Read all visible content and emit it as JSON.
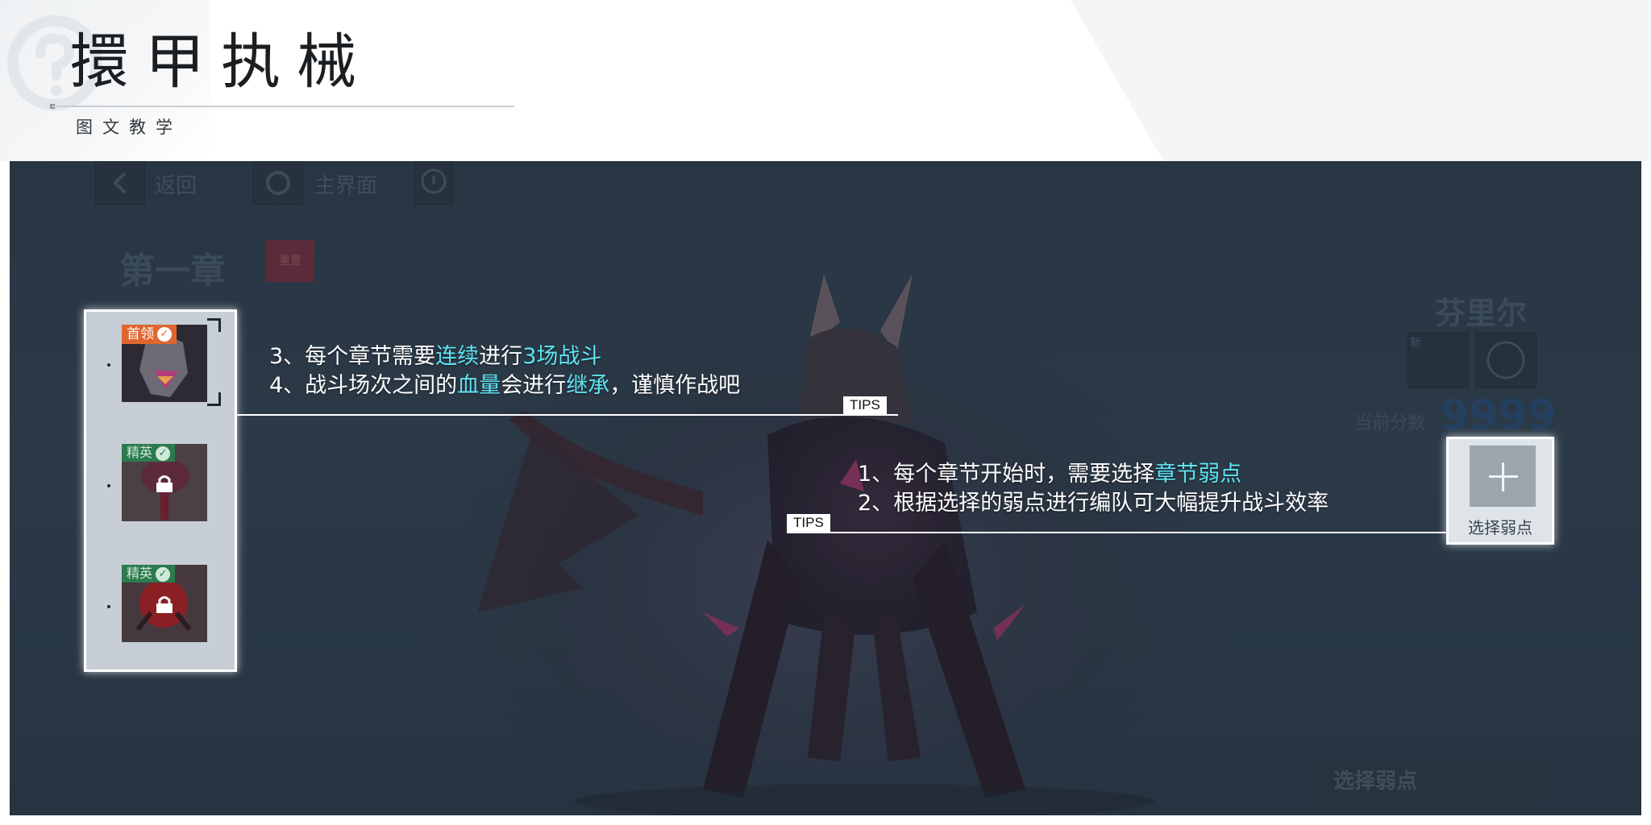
{
  "header": {
    "title": "擐甲执械",
    "subtitle": "图文教学"
  },
  "game": {
    "back_label": "返回",
    "home_label": "主界面",
    "chapter_title": "第一章",
    "chapter_tag": "重置",
    "boss_name": "芬里尔",
    "boss_icon_tag": "新",
    "score_label": "当前分数",
    "score_value": "9999",
    "bottom_button": "选择弱点",
    "stages": [
      {
        "badge": "首领",
        "locked": false
      },
      {
        "badge": "精英",
        "locked": true
      },
      {
        "badge": "精英",
        "locked": true
      }
    ]
  },
  "tips": {
    "label": "TIPS",
    "upper": {
      "line1": {
        "p1": "3、每个章节需要",
        "h1": "连续",
        "p2": "进行",
        "h2": "3场战斗"
      },
      "line2": {
        "p1": "4、战斗场次之间的",
        "h1": "血量",
        "p2": "会进行",
        "h2": "继承",
        "p3": "，谨慎作战吧"
      }
    },
    "lower": {
      "line1": {
        "p1": "1、每个章节开始时，需要选择",
        "h1": "章节弱点"
      },
      "line2": {
        "p1": "2、根据选择的弱点进行编队可大幅提升战斗效率"
      }
    }
  },
  "weakness_panel": {
    "label": "选择弱点"
  },
  "colors": {
    "highlight": "#5fe3f2",
    "boss_badge": "#e0662e",
    "elite_badge": "#2c7a4e",
    "score": "#24405e"
  }
}
